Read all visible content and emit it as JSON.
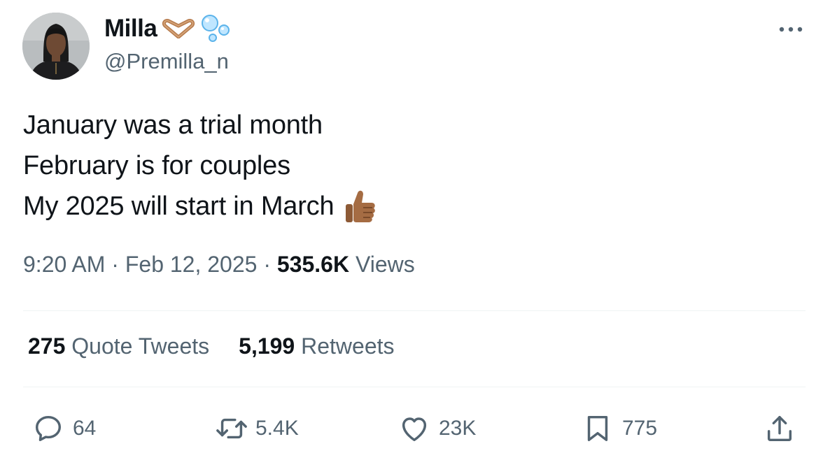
{
  "user": {
    "display_name": "Milla",
    "handle": "@Premilla_n",
    "name_emojis": [
      "heart-hands-emoji",
      "bubbles-emoji"
    ]
  },
  "tweet": {
    "lines": [
      "January was a trial month",
      "February is for couples",
      "My 2025 will start in March"
    ],
    "trailing_emoji": "thumbs-up-medium-dark-skin-emoji",
    "time": "9:20 AM",
    "separator": " · ",
    "date": "Feb 12, 2025",
    "views_count": "535.6K",
    "views_label": "Views"
  },
  "stats": {
    "quotes_count": "275",
    "quotes_label": "Quote Tweets",
    "retweets_count": "5,199",
    "retweets_label": "Retweets"
  },
  "actions": {
    "reply_count": "64",
    "retweet_count": "5.4K",
    "like_count": "23K",
    "bookmark_count": "775"
  },
  "colors": {
    "text_primary": "#0f1419",
    "text_secondary": "#536471",
    "divider": "#eff3f4",
    "skin_tone": "#a56c43"
  }
}
